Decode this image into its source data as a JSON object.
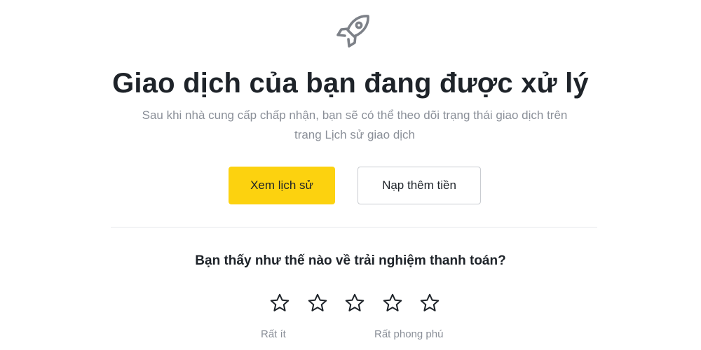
{
  "header": {
    "icon": "rocket-icon",
    "title": "Giao dịch của bạn đang được xử lý",
    "subtitle_line1": "Sau khi nhà cung cấp chấp nhận, bạn sẽ có thể theo dõi trạng thái giao dịch trên",
    "subtitle_line2": "trang Lịch sử giao dịch"
  },
  "actions": {
    "view_history_label": "Xem lịch sử",
    "add_funds_label": "Nạp thêm tiền"
  },
  "feedback": {
    "question": "Bạn thấy như thế nào về trải nghiệm thanh toán?",
    "stars": [
      "star-1",
      "star-2",
      "star-3",
      "star-4",
      "star-5"
    ],
    "low_label": "Rất ít",
    "high_label": "Rất phong phú"
  },
  "colors": {
    "accent": "#fcd20f",
    "text": "#1e2329",
    "muted": "#8a8f98",
    "border": "#c9ccd1"
  }
}
